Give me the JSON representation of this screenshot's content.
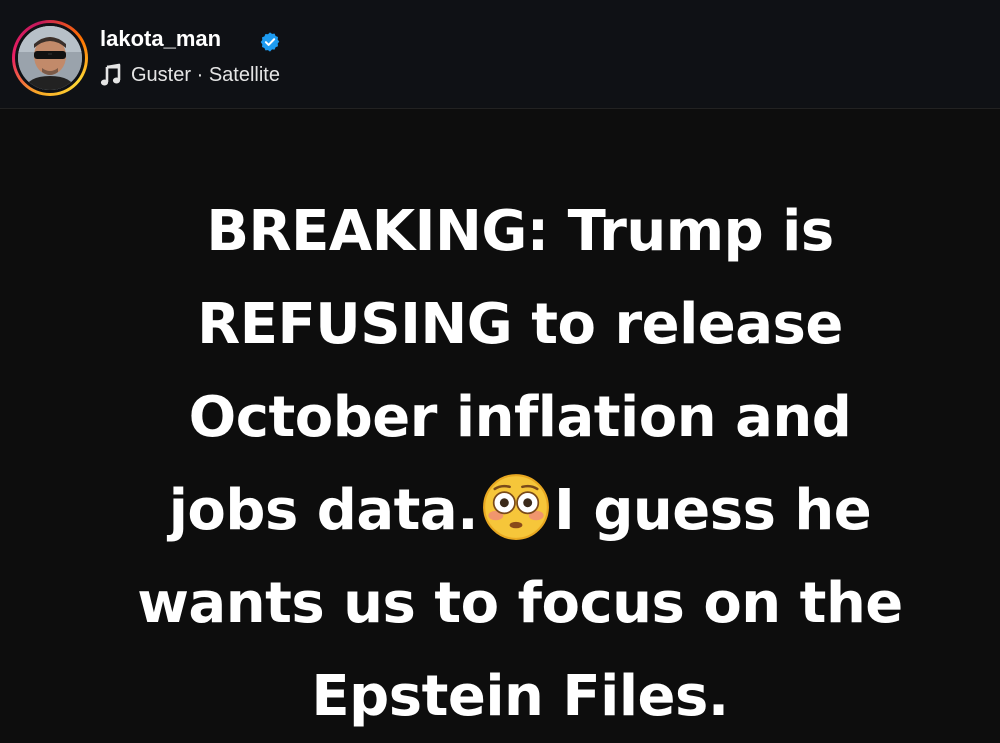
{
  "header": {
    "username": "lakota_man",
    "verified": true,
    "music": {
      "artist": "Guster",
      "separator": " · ",
      "track": "Satellite",
      "icon": "music-note-icon"
    },
    "avatar_ring_colors": [
      "#f9a825",
      "#e91e63",
      "#c2185b",
      "#ff6f00",
      "#fdd835"
    ],
    "verified_color": "#1d9bf0"
  },
  "post": {
    "background": "#0d0d0d",
    "text_color": "#ffffff",
    "lines": [
      {
        "before": "BREAKING: Trump is"
      },
      {
        "before": "REFUSING to release"
      },
      {
        "before": "October inflation and"
      },
      {
        "before": "jobs data.",
        "emoji": "flushed-face-emoji",
        "after": "I guess he"
      },
      {
        "before": "wants us to focus on the"
      },
      {
        "before": "Epstein Files."
      }
    ]
  }
}
